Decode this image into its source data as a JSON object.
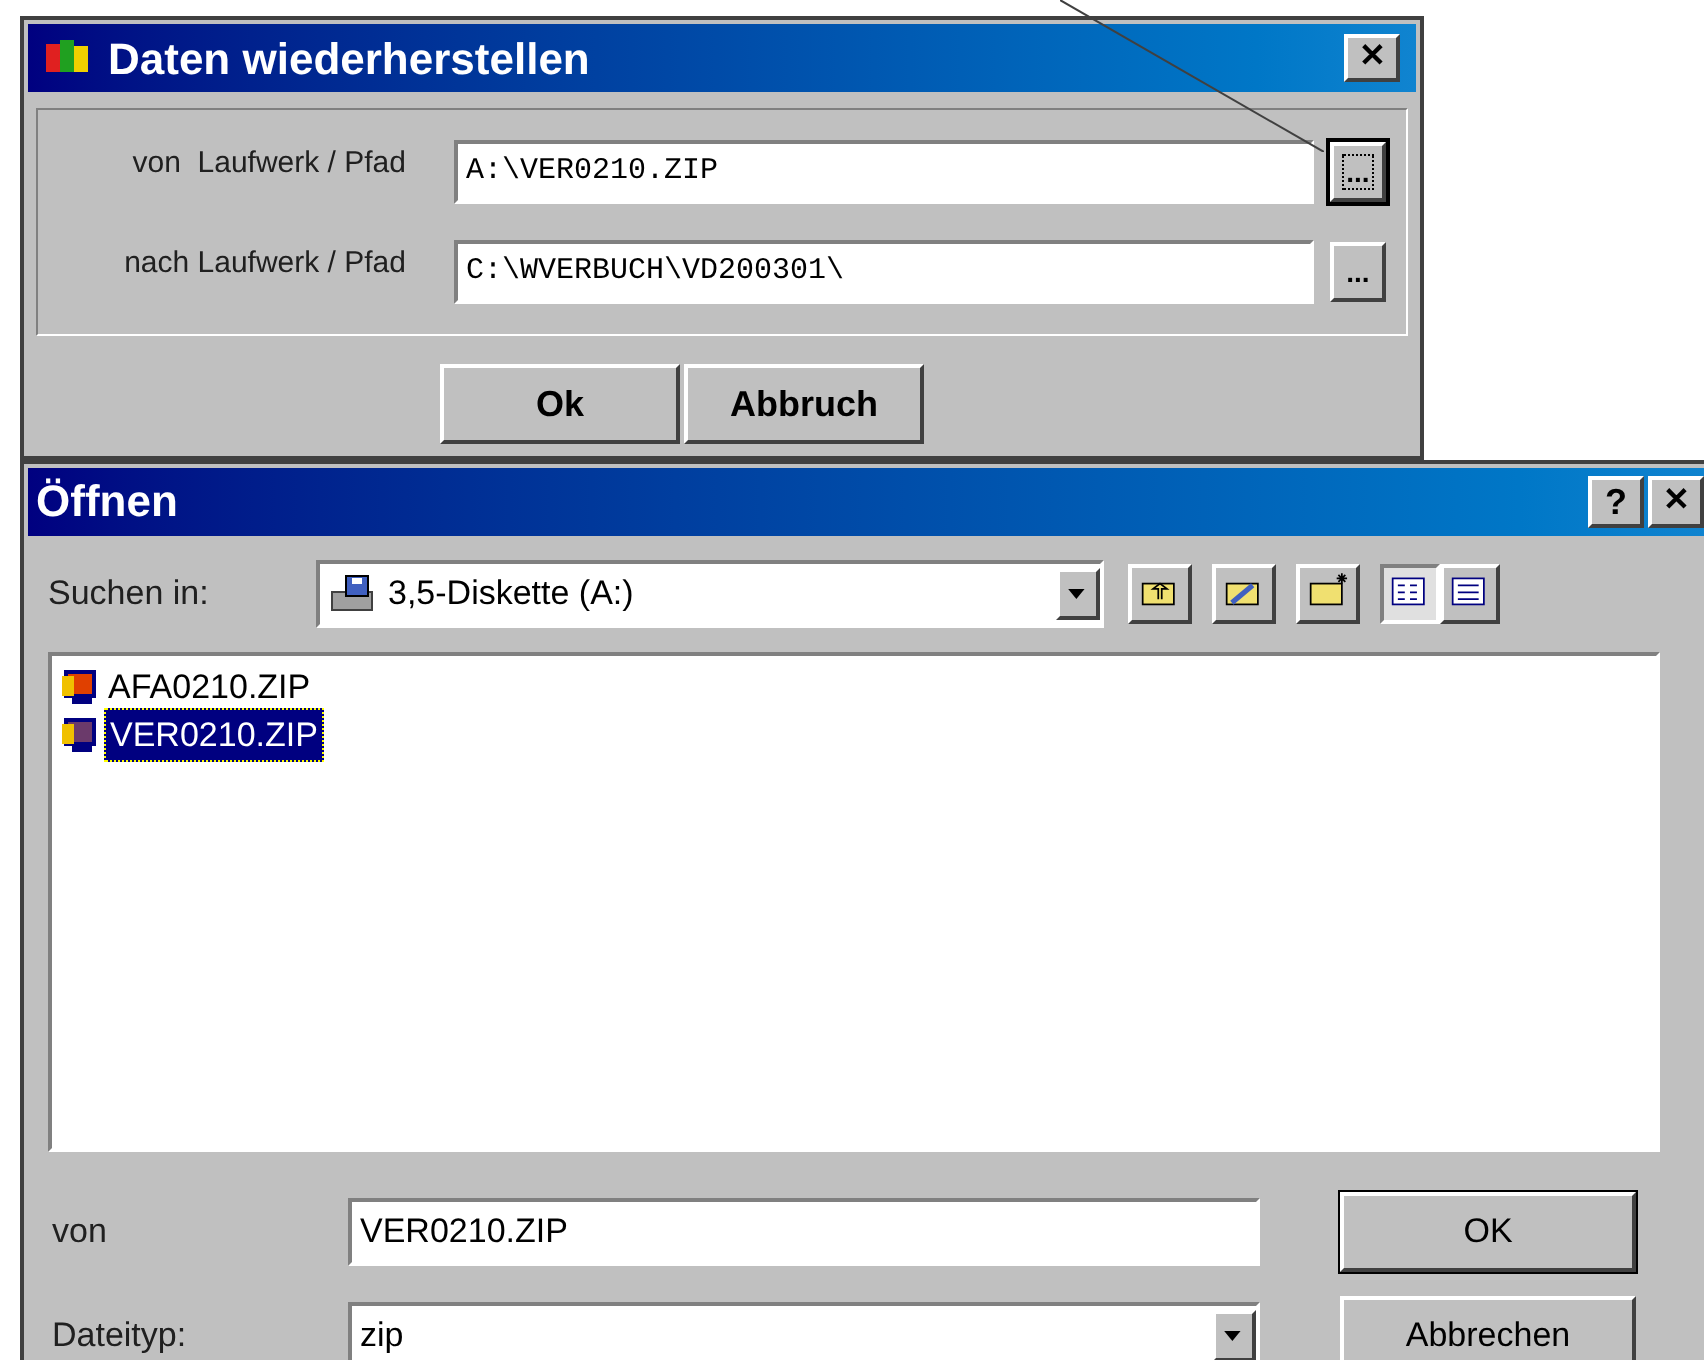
{
  "restore_dialog": {
    "title": "Daten wiederherstellen",
    "close": "✕",
    "fields": [
      {
        "label": "von  Laufwerk / Pfad",
        "value": "A:\\VER0210.ZIP",
        "browse": "...",
        "focused": true
      },
      {
        "label": "nach Laufwerk / Pfad",
        "value": "C:\\WVERBUCH\\VD200301\\",
        "browse": "...",
        "focused": false
      }
    ],
    "buttons": [
      "Ok",
      "Abbruch"
    ]
  },
  "open_dialog": {
    "title": "Öffnen",
    "help": "?",
    "close": "✕",
    "look_in": {
      "label": "Suchen in:",
      "value": "3,5-Diskette (A:)"
    },
    "files": [
      {
        "name": "AFA0210.ZIP",
        "selected": false
      },
      {
        "name": "VER0210.ZIP",
        "selected": true
      }
    ],
    "filename": {
      "label": "von",
      "value": "VER0210.ZIP"
    },
    "filetype": {
      "label": "Dateityp:",
      "value": "zip"
    },
    "buttons": [
      "OK",
      "Abbrechen"
    ]
  }
}
